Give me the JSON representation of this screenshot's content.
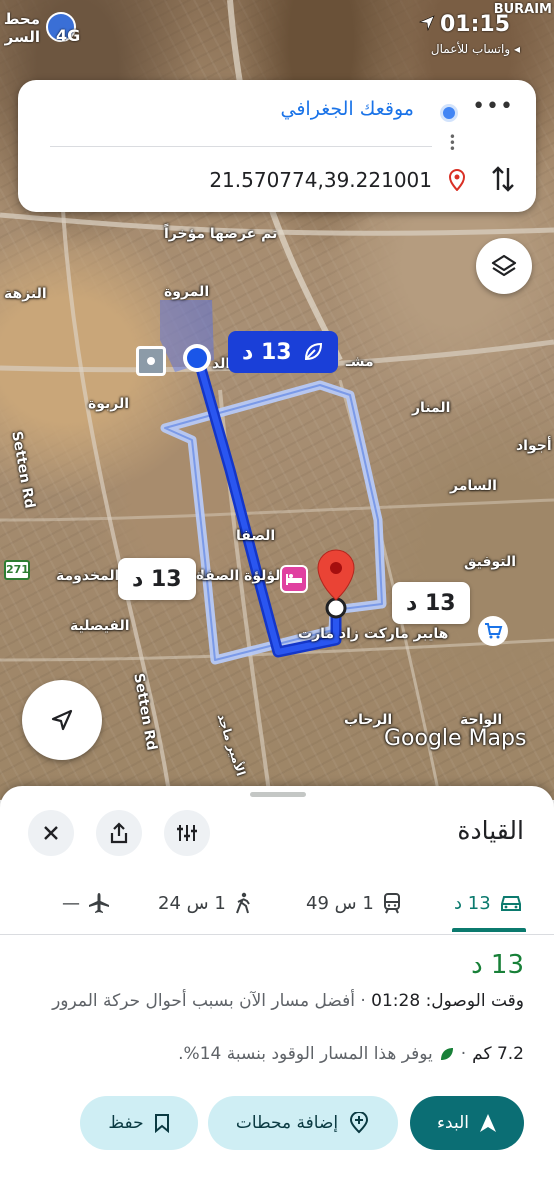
{
  "status_bar": {
    "time": "01:15",
    "carrier": "BURAIM",
    "back_app": "واتساب للأعمال",
    "signal": "4G",
    "left_text": "محط\nالسر"
  },
  "directions": {
    "from": "موقعك الجغرافي",
    "to": "21.570774,39.221001"
  },
  "map": {
    "labels": {
      "nuzha": "النزهة",
      "marwa": "المروة",
      "rabwa": "الربوة",
      "safa": "الصفا",
      "lulua": "لؤلؤة الصفا",
      "makhdooma": "المخدومة",
      "faisaliya": "الفيصلية",
      "manar": "المنار",
      "samer": "السامر",
      "tawfiq": "التوفيق",
      "rehab": "الرحاب",
      "waha": "الواحة",
      "ajwad": "أجواد",
      "recent": "تم عرضها مؤخراً",
      "hypermarket": "هايبر ماركت زاد مارت",
      "setten_top": "Setten Rd",
      "setten_bottom": "Setten Rd",
      "road_num": "271",
      "partial_top": "الد",
      "partial_left": "ة",
      "road_name": "الأمير ماجد",
      "mushrefa": "مشـ"
    },
    "bubbles": {
      "primary": "13 د",
      "alt_left": "13 د",
      "alt_right": "13 د"
    },
    "watermark": "Google Maps"
  },
  "sheet": {
    "title": "القيادة",
    "modes": [
      {
        "name": "driving",
        "label": "13 د"
      },
      {
        "name": "transit",
        "label": "1 س 49"
      },
      {
        "name": "walking",
        "label": "1 س 24"
      },
      {
        "name": "flight",
        "label": "—"
      }
    ],
    "route": {
      "duration": "13 د",
      "arrival": "وقت الوصول: 01:28",
      "description": " · أفضل مسار الآن بسبب أحوال حركة المرور",
      "distance": "7.2 كم",
      "eco": "يوفر هذا المسار الوقود بنسبة 14%."
    },
    "buttons": {
      "start": "البدء",
      "add_stops": "إضافة محطات",
      "save": "حفظ"
    }
  },
  "colors": {
    "route_primary": "#1a3fd8",
    "route_alt": "#b7c9f5",
    "accent_green": "#188038",
    "teal": "#0b6e74"
  }
}
